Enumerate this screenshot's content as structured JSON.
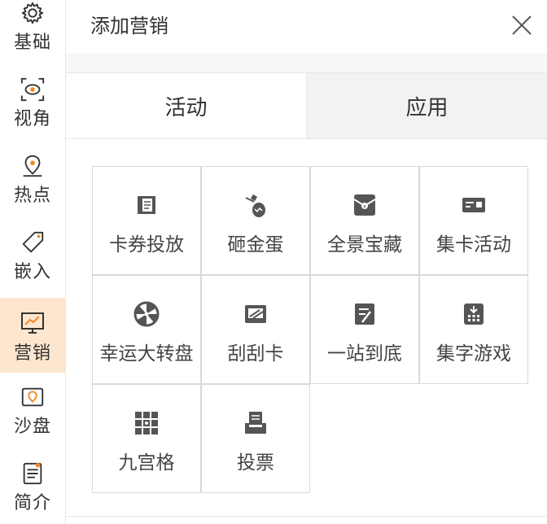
{
  "sidebar": {
    "items": [
      {
        "label": "基础",
        "icon": "gear-icon"
      },
      {
        "label": "视角",
        "icon": "view-icon"
      },
      {
        "label": "热点",
        "icon": "map-pin-icon"
      },
      {
        "label": "嵌入",
        "icon": "tag-icon"
      },
      {
        "label": "营销",
        "icon": "chart-monitor-icon",
        "active": true
      },
      {
        "label": "沙盘",
        "icon": "map-icon"
      },
      {
        "label": "简介",
        "icon": "document-icon"
      }
    ],
    "active_bg": "#fde6cf"
  },
  "panel": {
    "title": "添加营销",
    "close_icon": "close-icon"
  },
  "tabs": [
    {
      "label": "活动",
      "active": true
    },
    {
      "label": "应用",
      "active": false
    }
  ],
  "grid": {
    "items": [
      {
        "label": "卡券投放",
        "icon": "coupon-icon"
      },
      {
        "label": "砸金蛋",
        "icon": "hammer-egg-icon"
      },
      {
        "label": "全景宝藏",
        "icon": "treasure-bag-icon"
      },
      {
        "label": "集卡活动",
        "icon": "card-collect-icon"
      },
      {
        "label": "幸运大转盘",
        "icon": "lucky-wheel-icon"
      },
      {
        "label": "刮刮卡",
        "icon": "scratch-card-icon"
      },
      {
        "label": "一站到底",
        "icon": "quiz-icon"
      },
      {
        "label": "集字游戏",
        "icon": "word-collect-icon"
      },
      {
        "label": "九宫格",
        "icon": "nine-grid-icon"
      },
      {
        "label": "投票",
        "icon": "vote-icon"
      }
    ]
  }
}
